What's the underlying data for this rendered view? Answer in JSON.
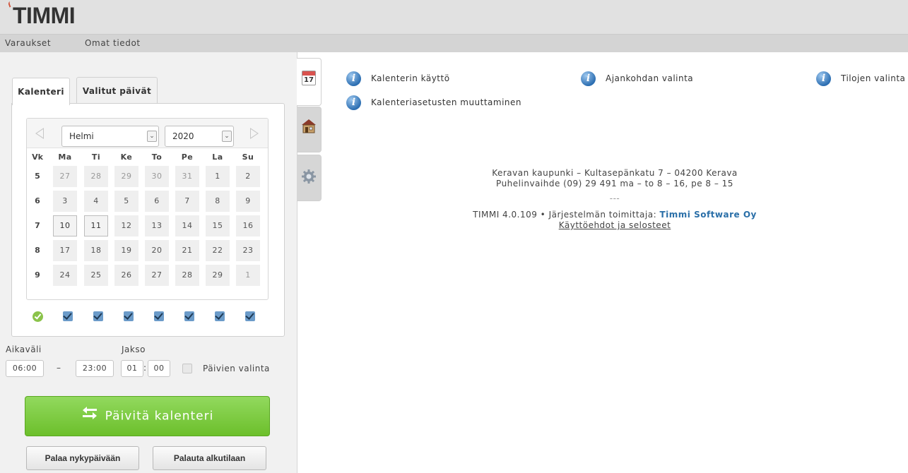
{
  "app": {
    "logo": "TIMMI"
  },
  "nav": {
    "items": [
      "Varaukset",
      "Omat tiedot"
    ]
  },
  "tabs": {
    "calendar": "Kalenteri",
    "selected_days": "Valitut päivät"
  },
  "calendar": {
    "month": "Helmi",
    "year": "2020",
    "headers": [
      "Vk",
      "Ma",
      "Ti",
      "Ke",
      "To",
      "Pe",
      "La",
      "Su"
    ],
    "weeks": [
      {
        "wk": "5",
        "days": [
          "27",
          "28",
          "29",
          "30",
          "31",
          "1",
          "2"
        ]
      },
      {
        "wk": "6",
        "days": [
          "3",
          "4",
          "5",
          "6",
          "7",
          "8",
          "9"
        ]
      },
      {
        "wk": "7",
        "days": [
          "10",
          "11",
          "12",
          "13",
          "14",
          "15",
          "16"
        ]
      },
      {
        "wk": "8",
        "days": [
          "17",
          "18",
          "19",
          "20",
          "21",
          "22",
          "23"
        ]
      },
      {
        "wk": "9",
        "days": [
          "24",
          "25",
          "26",
          "27",
          "28",
          "29",
          "1"
        ]
      }
    ]
  },
  "time": {
    "aikavali_label": "Aikaväli",
    "jakso_label": "Jakso",
    "start": "06:00",
    "dash": "–",
    "end": "23:00",
    "jakso_h": "01",
    "colon": ":",
    "jakso_m": "00",
    "paivien_valinta": "Päivien valinta"
  },
  "buttons": {
    "update": "Päivitä kalenteri",
    "today": "Palaa nykypäivään",
    "reset": "Palauta alkutilaan"
  },
  "side_tabs": {
    "calendar_day": "17"
  },
  "help": {
    "calendar_use": "Kalenterin käyttö",
    "time_selection": "Ajankohdan valinta",
    "space_selection": "Tilojen valinta",
    "calendar_settings": "Kalenteriasetusten muuttaminen"
  },
  "footer": {
    "line1": "Keravan kaupunki – Kultasepänkatu 7 – 04200 Kerava",
    "line2": "Puhelinvaihde (09) 29 491 ma – to 8 – 16, pe 8 – 15",
    "separator": "---",
    "version_prefix": "TIMMI 4.0.109 • Järjestelmän toimittaja: ",
    "vendor": "Timmi Software Oy",
    "terms": "Käyttöehdot ja selosteet"
  },
  "colors": {
    "update_button": "#6cbf2b",
    "checkbox": "#6b9bc9",
    "info_icon": "#2d6fb2",
    "vendor_link": "#2a6fa8"
  }
}
